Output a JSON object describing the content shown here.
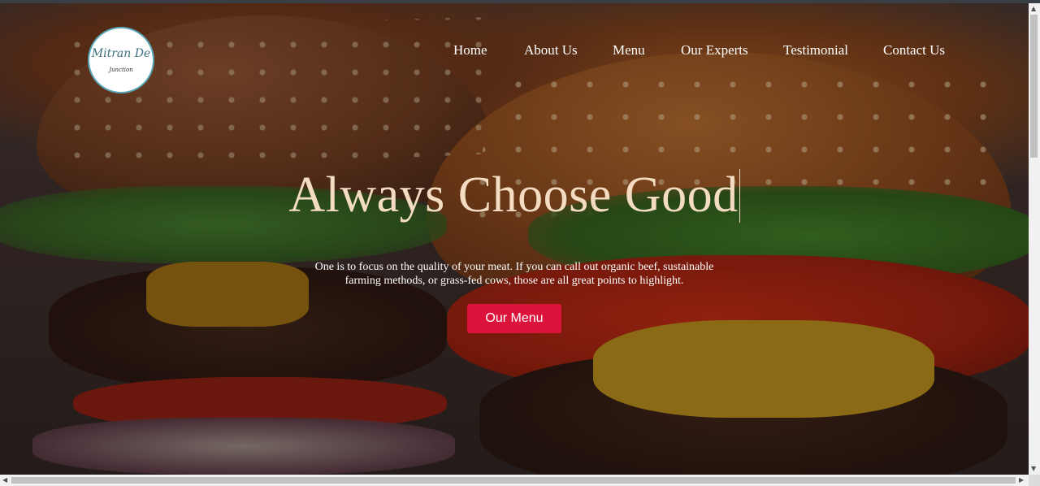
{
  "logo": {
    "main": "Mitran De",
    "sub": "Junction"
  },
  "nav": {
    "items": [
      "Home",
      "About Us",
      "Menu",
      "Our Experts",
      "Testimonial",
      "Contact Us"
    ]
  },
  "hero": {
    "headline": "Always Choose Good",
    "line1": "One is to focus on the quality of your meat. If you can call out organic beef, sustainable",
    "line2": "farming methods, or grass-fed cows, those are all great points to highlight.",
    "cta": "Our Menu",
    "cta_color": "#dc143c",
    "headline_color": "#f4dcc2"
  },
  "scrollbars": {
    "up_arrow": "▲",
    "down_arrow": "▼",
    "left_arrow": "◀",
    "right_arrow": "▶"
  }
}
